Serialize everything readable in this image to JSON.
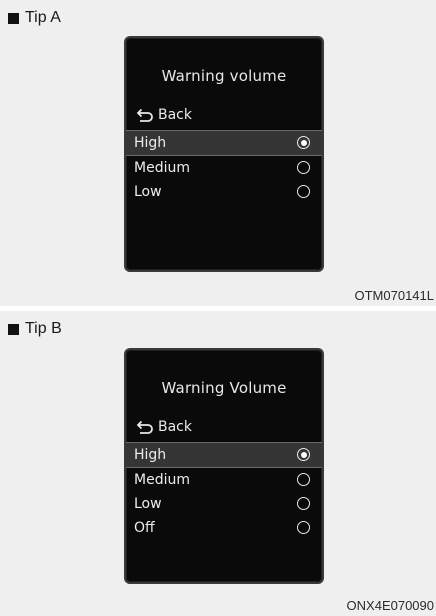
{
  "tip_a": {
    "label": "Tip A",
    "code": "OTM070141L",
    "screen": {
      "title": "Warning volume",
      "back_label": "Back",
      "options": [
        {
          "label": "High",
          "selected": true
        },
        {
          "label": "Medium",
          "selected": false
        },
        {
          "label": "Low",
          "selected": false
        }
      ]
    }
  },
  "tip_b": {
    "label": "Tip B",
    "code": "ONX4E070090",
    "screen": {
      "title": "Warning Volume",
      "back_label": "Back",
      "options": [
        {
          "label": "High",
          "selected": true
        },
        {
          "label": "Medium",
          "selected": false
        },
        {
          "label": "Low",
          "selected": false
        },
        {
          "label": "Off",
          "selected": false
        }
      ]
    }
  },
  "icons": {
    "bullet": "square-bullet-icon",
    "back": "back-arrow-icon",
    "radio_on": "radio-selected-icon",
    "radio_off": "radio-unselected-icon"
  },
  "colors": {
    "panel_bg": "#efefef",
    "screen_bg": "#0a0a0a",
    "highlight": "#353535",
    "text": "#ffffff"
  }
}
